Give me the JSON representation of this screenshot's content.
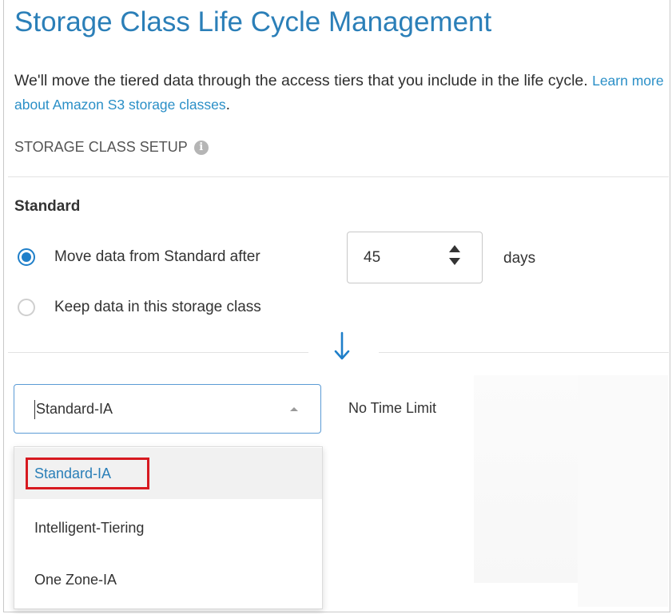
{
  "header": {
    "title": "Storage Class Life Cycle Management",
    "description": "We'll move the tiered data through the access tiers that you include in the life cycle.",
    "learn_more_link": "Learn more about Amazon S3 storage classes",
    "description_end": "."
  },
  "setup": {
    "section_label": "STORAGE CLASS SETUP",
    "info_icon": "info-icon",
    "class_name": "Standard",
    "move_option_label": "Move data from Standard after",
    "move_option_selected": true,
    "keep_option_label": "Keep data in this storage class",
    "keep_option_selected": false,
    "days_value": "45",
    "days_unit": "days"
  },
  "next_tier": {
    "selected_class": "Standard-IA",
    "time_limit": "No Time Limit",
    "options": [
      {
        "label": "Standard-IA",
        "selected": true
      },
      {
        "label": "Intelligent-Tiering",
        "selected": false
      },
      {
        "label": "One Zone-IA",
        "selected": false
      }
    ]
  },
  "colors": {
    "title": "#2b7fb8",
    "link": "#2a8fc7",
    "radio_checked": "#1f7fc9",
    "highlight_border": "#d71920",
    "select_border": "#5b9bd5"
  }
}
